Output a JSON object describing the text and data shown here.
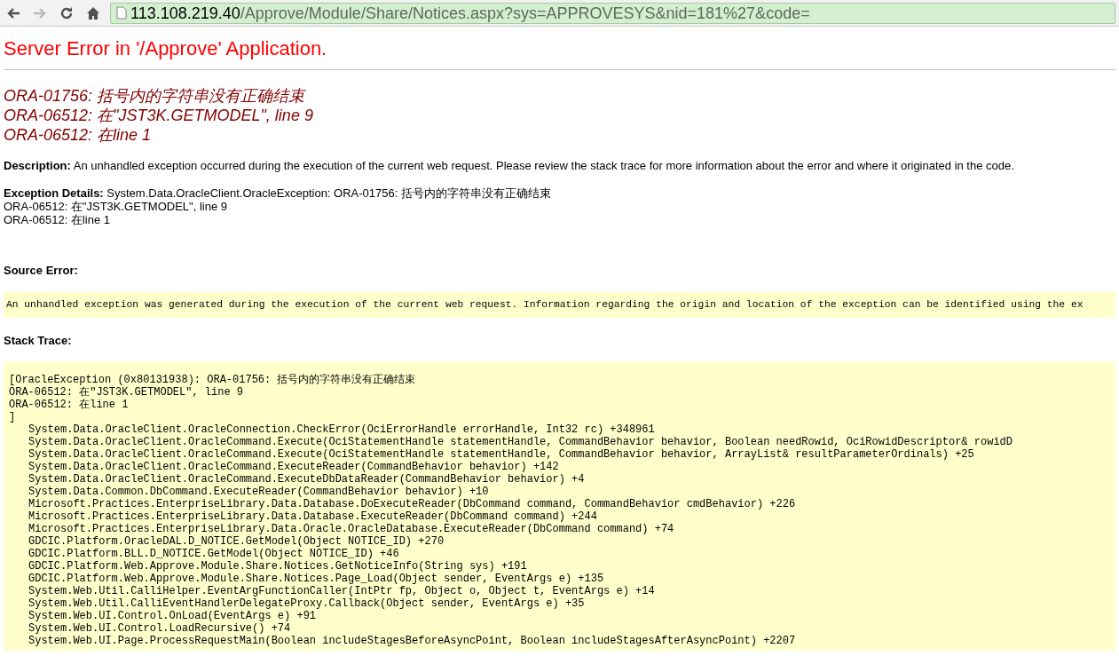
{
  "browser": {
    "nav_buttons": [
      {
        "kind": "back",
        "disabled": false
      },
      {
        "kind": "forward",
        "disabled": true
      },
      {
        "kind": "reload",
        "disabled": false
      },
      {
        "kind": "home",
        "disabled": false
      }
    ],
    "address": {
      "host": "113.108.219.40",
      "path": "/Approve/Module/Share/Notices.aspx?sys=APPROVESYS&nid=181%27&code="
    }
  },
  "page": {
    "title": "Server Error in '/Approve' Application.",
    "error_lines": [
      "ORA-01756: 括号内的字符串没有正确结束",
      "ORA-06512: 在\"JST3K.GETMODEL\", line 9",
      "ORA-06512: 在line 1"
    ],
    "description": {
      "label": "Description:",
      "text": "An unhandled exception occurred during the execution of the current web request. Please review the stack trace for more information about the error and where it originated in the code."
    },
    "exception_details": {
      "label": "Exception Details:",
      "text": "System.Data.OracleClient.OracleException: ORA-01756: 括号内的字符串没有正确结束",
      "lines": [
        "ORA-06512: 在\"JST3K.GETMODEL\", line 9",
        "ORA-06512: 在line 1"
      ]
    },
    "source_error": {
      "heading": "Source Error:",
      "text": "An unhandled exception was generated during the execution of the current web request. Information regarding the origin and location of the exception can be identified using the ex"
    },
    "stack_trace": {
      "heading": "Stack Trace:",
      "message_lines": [
        "[OracleException (0x80131938): ORA-01756: 括号内的字符串没有正确结束",
        "ORA-06512: 在\"JST3K.GETMODEL\", line 9",
        "ORA-06512: 在line 1",
        "]"
      ],
      "frames": [
        "System.Data.OracleClient.OracleConnection.CheckError(OciErrorHandle errorHandle, Int32 rc) +348961",
        "System.Data.OracleClient.OracleCommand.Execute(OciStatementHandle statementHandle, CommandBehavior behavior, Boolean needRowid, OciRowidDescriptor& rowidD",
        "System.Data.OracleClient.OracleCommand.Execute(OciStatementHandle statementHandle, CommandBehavior behavior, ArrayList& resultParameterOrdinals) +25",
        "System.Data.OracleClient.OracleCommand.ExecuteReader(CommandBehavior behavior) +142",
        "System.Data.OracleClient.OracleCommand.ExecuteDbDataReader(CommandBehavior behavior) +4",
        "System.Data.Common.DbCommand.ExecuteReader(CommandBehavior behavior) +10",
        "Microsoft.Practices.EnterpriseLibrary.Data.Database.DoExecuteReader(DbCommand command, CommandBehavior cmdBehavior) +226",
        "Microsoft.Practices.EnterpriseLibrary.Data.Database.ExecuteReader(DbCommand command) +244",
        "Microsoft.Practices.EnterpriseLibrary.Data.Oracle.OracleDatabase.ExecuteReader(DbCommand command) +74",
        "GDCIC.Platform.OracleDAL.D_NOTICE.GetModel(Object NOTICE_ID) +270",
        "GDCIC.Platform.BLL.D_NOTICE.GetModel(Object NOTICE_ID) +46",
        "GDCIC.Platform.Web.Approve.Module.Share.Notices.GetNoticeInfo(String sys) +191",
        "GDCIC.Platform.Web.Approve.Module.Share.Notices.Page_Load(Object sender, EventArgs e) +135",
        "System.Web.Util.CalliHelper.EventArgFunctionCaller(IntPtr fp, Object o, Object t, EventArgs e) +14",
        "System.Web.Util.CalliEventHandlerDelegateProxy.Callback(Object sender, EventArgs e) +35",
        "System.Web.UI.Control.OnLoad(EventArgs e) +91",
        "System.Web.UI.Control.LoadRecursive() +74",
        "System.Web.UI.Page.ProcessRequestMain(Boolean includeStagesBeforeAsyncPoint, Boolean includeStagesAfterAsyncPoint) +2207"
      ]
    }
  }
}
